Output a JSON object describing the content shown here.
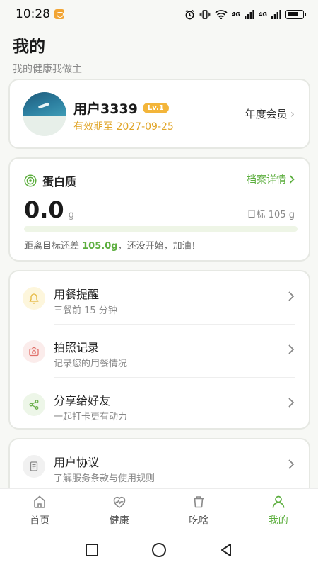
{
  "status_bar": {
    "time": "10:28",
    "network_1": "4G",
    "network_2": "4G"
  },
  "header": {
    "title": "我的",
    "subtitle": "我的健康我做主"
  },
  "profile": {
    "username": "用户3339",
    "level": "Lv.1",
    "expiry": "有效期至 2027-09-25",
    "membership": "年度会员"
  },
  "protein": {
    "label": "蛋白质",
    "profile_link": "档案详情",
    "value": "0.0",
    "unit": "g",
    "goal": "目标 105 g",
    "progress_fraction": 0,
    "message_prefix": "距离目标还差 ",
    "message_amount": "105.0g",
    "message_suffix": "，还没开始，加油！"
  },
  "menu": {
    "items": [
      {
        "title": "用餐提醒",
        "subtitle": "三餐前 15 分钟",
        "icon": "bell-icon",
        "icon_bg": "#fdf6dc",
        "icon_color": "#e4b53a"
      },
      {
        "title": "拍照记录",
        "subtitle": "记录您的用餐情况",
        "icon": "camera-icon",
        "icon_bg": "#fbeceb",
        "icon_color": "#e0706a"
      },
      {
        "title": "分享给好友",
        "subtitle": "一起打卡更有动力",
        "icon": "share-icon",
        "icon_bg": "#edf6e8",
        "icon_color": "#6cb04c"
      }
    ]
  },
  "legal": {
    "items": [
      {
        "title": "用户协议",
        "subtitle": "了解服务条款与使用规则",
        "icon": "document-icon"
      }
    ]
  },
  "bottom_nav": {
    "items": [
      {
        "label": "首页",
        "icon": "home-icon"
      },
      {
        "label": "健康",
        "icon": "heart-pulse-icon"
      },
      {
        "label": "吃啥",
        "icon": "trash-bin-icon"
      },
      {
        "label": "我的",
        "icon": "person-icon",
        "active": true
      }
    ]
  },
  "colors": {
    "accent": "#5cae3e",
    "gold": "#e0a426",
    "badge": "#f3b53a"
  }
}
